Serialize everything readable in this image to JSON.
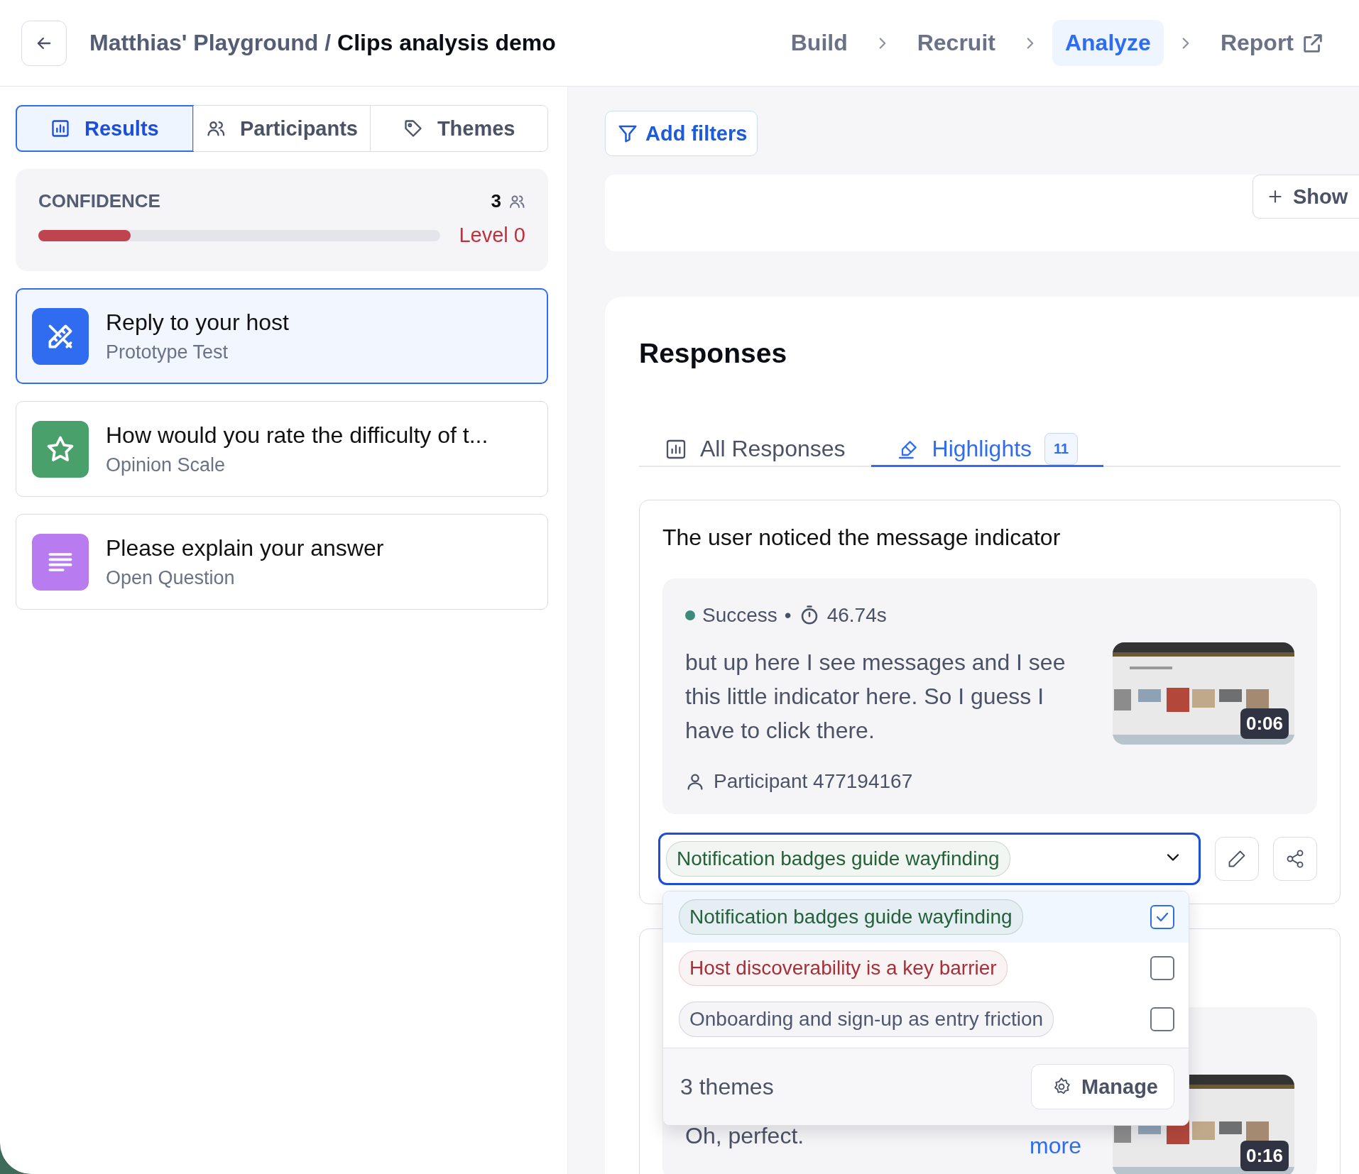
{
  "header": {
    "workspace": "Matthias' Playground /",
    "project": "Clips analysis demo",
    "steps": [
      {
        "label": "Build",
        "kind": "step",
        "selected": false
      },
      {
        "label": "Recruit",
        "kind": "step",
        "selected": false
      },
      {
        "label": "Analyze",
        "kind": "step",
        "selected": true
      },
      {
        "label": "Report",
        "kind": "external",
        "selected": false
      }
    ]
  },
  "sidebar": {
    "tabs": [
      {
        "label": "Results",
        "kind": "chart",
        "selected": true
      },
      {
        "label": "Participants",
        "kind": "people",
        "selected": false
      },
      {
        "label": "Themes",
        "kind": "tag",
        "selected": false
      }
    ],
    "confidence": {
      "label": "CONFIDENCE",
      "count": "3",
      "level": 0.23,
      "reading": "Level 0"
    },
    "blocks": [
      {
        "title": "Reply to your host",
        "type": "Prototype Test",
        "kind": "prototype",
        "selected": true
      },
      {
        "title": "How would you rate the difficulty of t...",
        "type": "Opinion Scale",
        "kind": "scale",
        "selected": false
      },
      {
        "title": "Please explain your answer",
        "type": "Open Question",
        "kind": "open",
        "selected": false
      }
    ]
  },
  "toolbar": {
    "filter_button": "Add filters",
    "show_button": "Show"
  },
  "responses": {
    "title": "Responses",
    "tabs": [
      {
        "label": "All Responses",
        "kind": "chart",
        "selected": false
      },
      {
        "label": "Highlights",
        "kind": "highlighter",
        "count": "11",
        "selected": true
      }
    ],
    "highlights": [
      {
        "title": "The user noticed the message indicator",
        "status": "Success",
        "separator": "•",
        "duration": "46.74s",
        "quote": "but up here I see messages and I see this little indicator here. So I guess I have to click there.",
        "participant": "Participant 477194167",
        "clip_time": "0:06",
        "theme": {
          "label": "Notification badges guide wayfinding",
          "color": "#25603a"
        }
      },
      {
        "quote": "Oh, perfect.",
        "more_link": "more",
        "clip_time": "0:16"
      }
    ],
    "theme_menu": {
      "options": [
        {
          "label": "Notification badges guide wayfinding",
          "color": "#25603a",
          "checked": true
        },
        {
          "label": "Host discoverability is a key barrier",
          "color": "#a3303a",
          "checked": false
        },
        {
          "label": "Onboarding and sign-up as entry friction",
          "color": "#4f5670",
          "checked": false
        }
      ],
      "count": "3 themes",
      "manage_button": "Manage"
    }
  }
}
